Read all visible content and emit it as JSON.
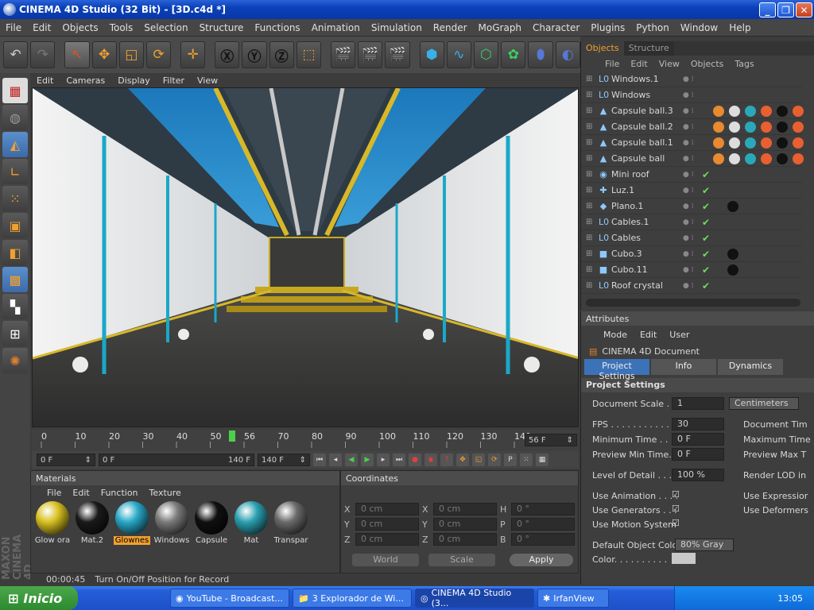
{
  "window": {
    "title": "CINEMA 4D Studio (32 Bit) - [3D.c4d *]"
  },
  "menubar": [
    "File",
    "Edit",
    "Objects",
    "Tools",
    "Selection",
    "Structure",
    "Functions",
    "Animation",
    "Simulation",
    "Render",
    "MoGraph",
    "Character",
    "Plugins",
    "Python",
    "Window",
    "Help"
  ],
  "viewport": {
    "menu": [
      "Edit",
      "Cameras",
      "Display",
      "Filter",
      "View"
    ]
  },
  "timeline": {
    "ticks": [
      "0",
      "10",
      "20",
      "30",
      "40",
      "50",
      "56",
      "70",
      "80",
      "90",
      "100",
      "110",
      "120",
      "130",
      "140"
    ],
    "current": "56 F"
  },
  "transport": {
    "start": "0 F",
    "range_start": "0 F",
    "range_end": "140 F",
    "end": "140 F"
  },
  "materials": {
    "title": "Materials",
    "menu": [
      "File",
      "Edit",
      "Function",
      "Texture"
    ],
    "items": [
      {
        "label": "Glow ora",
        "color": "#d8c020"
      },
      {
        "label": "Mat.2",
        "color": "#1a1a1a"
      },
      {
        "label": "Glownes",
        "color": "#28a8c8"
      },
      {
        "label": "Windows",
        "color": "#7a7a7a"
      },
      {
        "label": "Capsule",
        "color": "#101010"
      },
      {
        "label": "Mat",
        "color": "#2aa0b0"
      },
      {
        "label": "Transpar",
        "color": "#6a6a6a"
      }
    ]
  },
  "coordinates": {
    "title": "Coordinates",
    "rows": [
      {
        "a": "X",
        "av": "0 cm",
        "b": "X",
        "bv": "0 cm",
        "c": "H",
        "cv": "0 °"
      },
      {
        "a": "Y",
        "av": "0 cm",
        "b": "Y",
        "bv": "0 cm",
        "c": "P",
        "cv": "0 °"
      },
      {
        "a": "Z",
        "av": "0 cm",
        "b": "Z",
        "bv": "0 cm",
        "c": "B",
        "cv": "0 °"
      }
    ],
    "mode1": "World",
    "mode2": "Scale",
    "apply": "Apply"
  },
  "objects": {
    "tabs": [
      "Objects",
      "Structure"
    ],
    "menu": [
      "File",
      "Edit",
      "View",
      "Objects",
      "Tags"
    ],
    "items": [
      {
        "name": "Windows.1",
        "icon": "L0"
      },
      {
        "name": "Windows",
        "icon": "L0"
      },
      {
        "name": "Capsule ball.3",
        "icon": "▲"
      },
      {
        "name": "Capsule ball.2",
        "icon": "▲"
      },
      {
        "name": "Capsule ball.1",
        "icon": "▲"
      },
      {
        "name": "Capsule ball",
        "icon": "▲"
      },
      {
        "name": "Mini roof",
        "icon": "◉"
      },
      {
        "name": "Luz.1",
        "icon": "✚"
      },
      {
        "name": "Plano.1",
        "icon": "◆"
      },
      {
        "name": "Cables.1",
        "icon": "L0"
      },
      {
        "name": "Cables",
        "icon": "L0"
      },
      {
        "name": "Cubo.3",
        "icon": "■"
      },
      {
        "name": "Cubo.11",
        "icon": "■"
      },
      {
        "name": "Roof crystal",
        "icon": "L0"
      }
    ]
  },
  "attributes": {
    "title": "Attributes",
    "menu": [
      "Mode",
      "Edit",
      "User"
    ],
    "doc": "CINEMA 4D Document",
    "tabs": [
      "Project Settings",
      "Info",
      "Dynamics"
    ],
    "section": "Project Settings",
    "document_scale_label": "Document Scale . .",
    "document_scale": "1",
    "scale_unit": "Centimeters",
    "fps_label": "FPS . . . . . . . . . . . .",
    "fps": "30",
    "doc_time_label": "Document Tim",
    "min_time_label": "Minimum Time . . . .",
    "min_time": "0 F",
    "max_time_label": "Maximum Time",
    "prev_min_label": "Preview Min Time. .",
    "prev_min": "0 F",
    "prev_max_label": "Preview Max T",
    "lod_label": "Level of Detail . . . .",
    "lod": "100 %",
    "render_lod_label": "Render LOD in",
    "use_anim": "Use Animation . . . .",
    "use_expr": "Use Expressior",
    "use_gen": "Use Generators . . .",
    "use_def": "Use Deformers",
    "use_motion": "Use Motion System",
    "def_color_label": "Default Object Color",
    "def_color": "80% Gray",
    "color_label": "Color. . . . . . . . . ."
  },
  "status": {
    "time": "00:00:45",
    "text": "Turn On/Off Position for Record"
  },
  "taskbar": {
    "start": "Inicio",
    "tasks": [
      "YouTube - Broadcast...",
      "3 Explorador de Wi...",
      "CINEMA 4D Studio (3...",
      "IrfanView"
    ],
    "clock": "13:05"
  }
}
